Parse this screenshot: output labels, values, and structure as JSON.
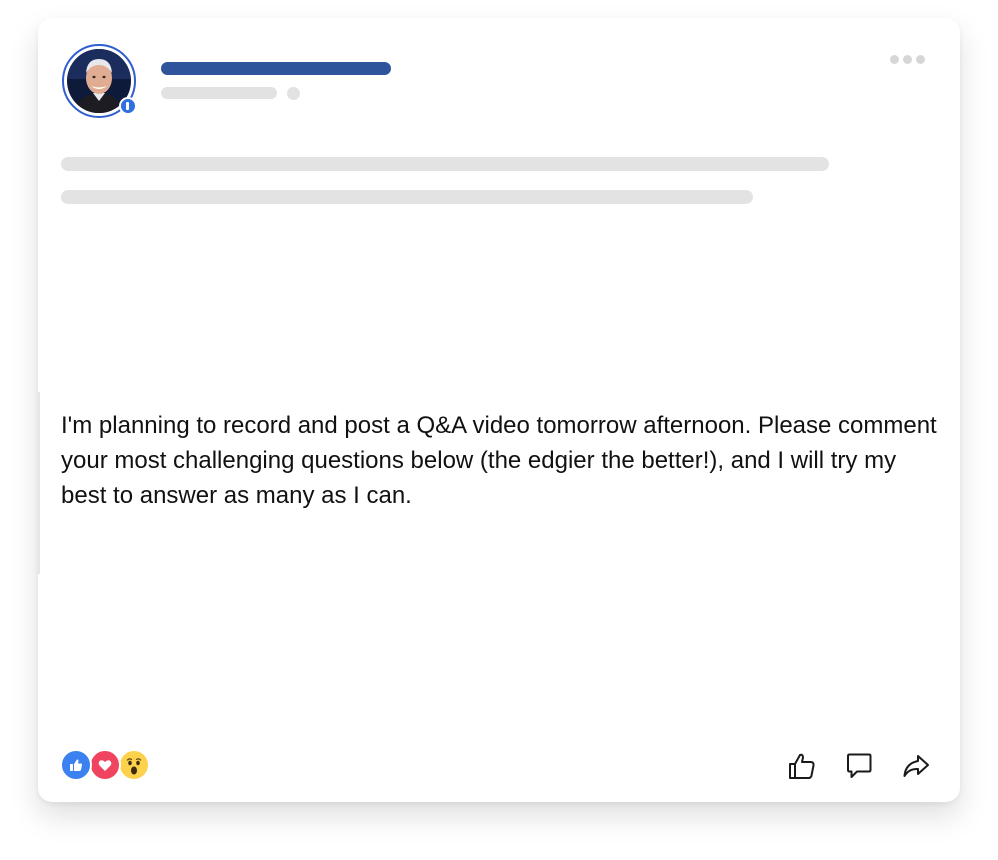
{
  "post": {
    "text": "I'm planning to record and post a Q&A video tomorrow afternoon. Please comment your most challenging questions below (the edgier the better!), and I will try my best to answer as many as I can."
  },
  "header": {
    "avatar": "profile-photo",
    "badge": "verified-badge-icon",
    "more_menu": "more-options-icon"
  },
  "reactions": [
    "like-reaction-icon",
    "love-reaction-icon",
    "wow-reaction-icon"
  ],
  "actions": [
    "like-icon",
    "comment-icon",
    "share-icon"
  ],
  "colors": {
    "accent": "#2f549c",
    "avatar_ring": "#2f5fcf",
    "placeholder": "#e3e3e3",
    "like": "#3b82f0",
    "love": "#f0435f",
    "wow": "#fcd24c"
  }
}
